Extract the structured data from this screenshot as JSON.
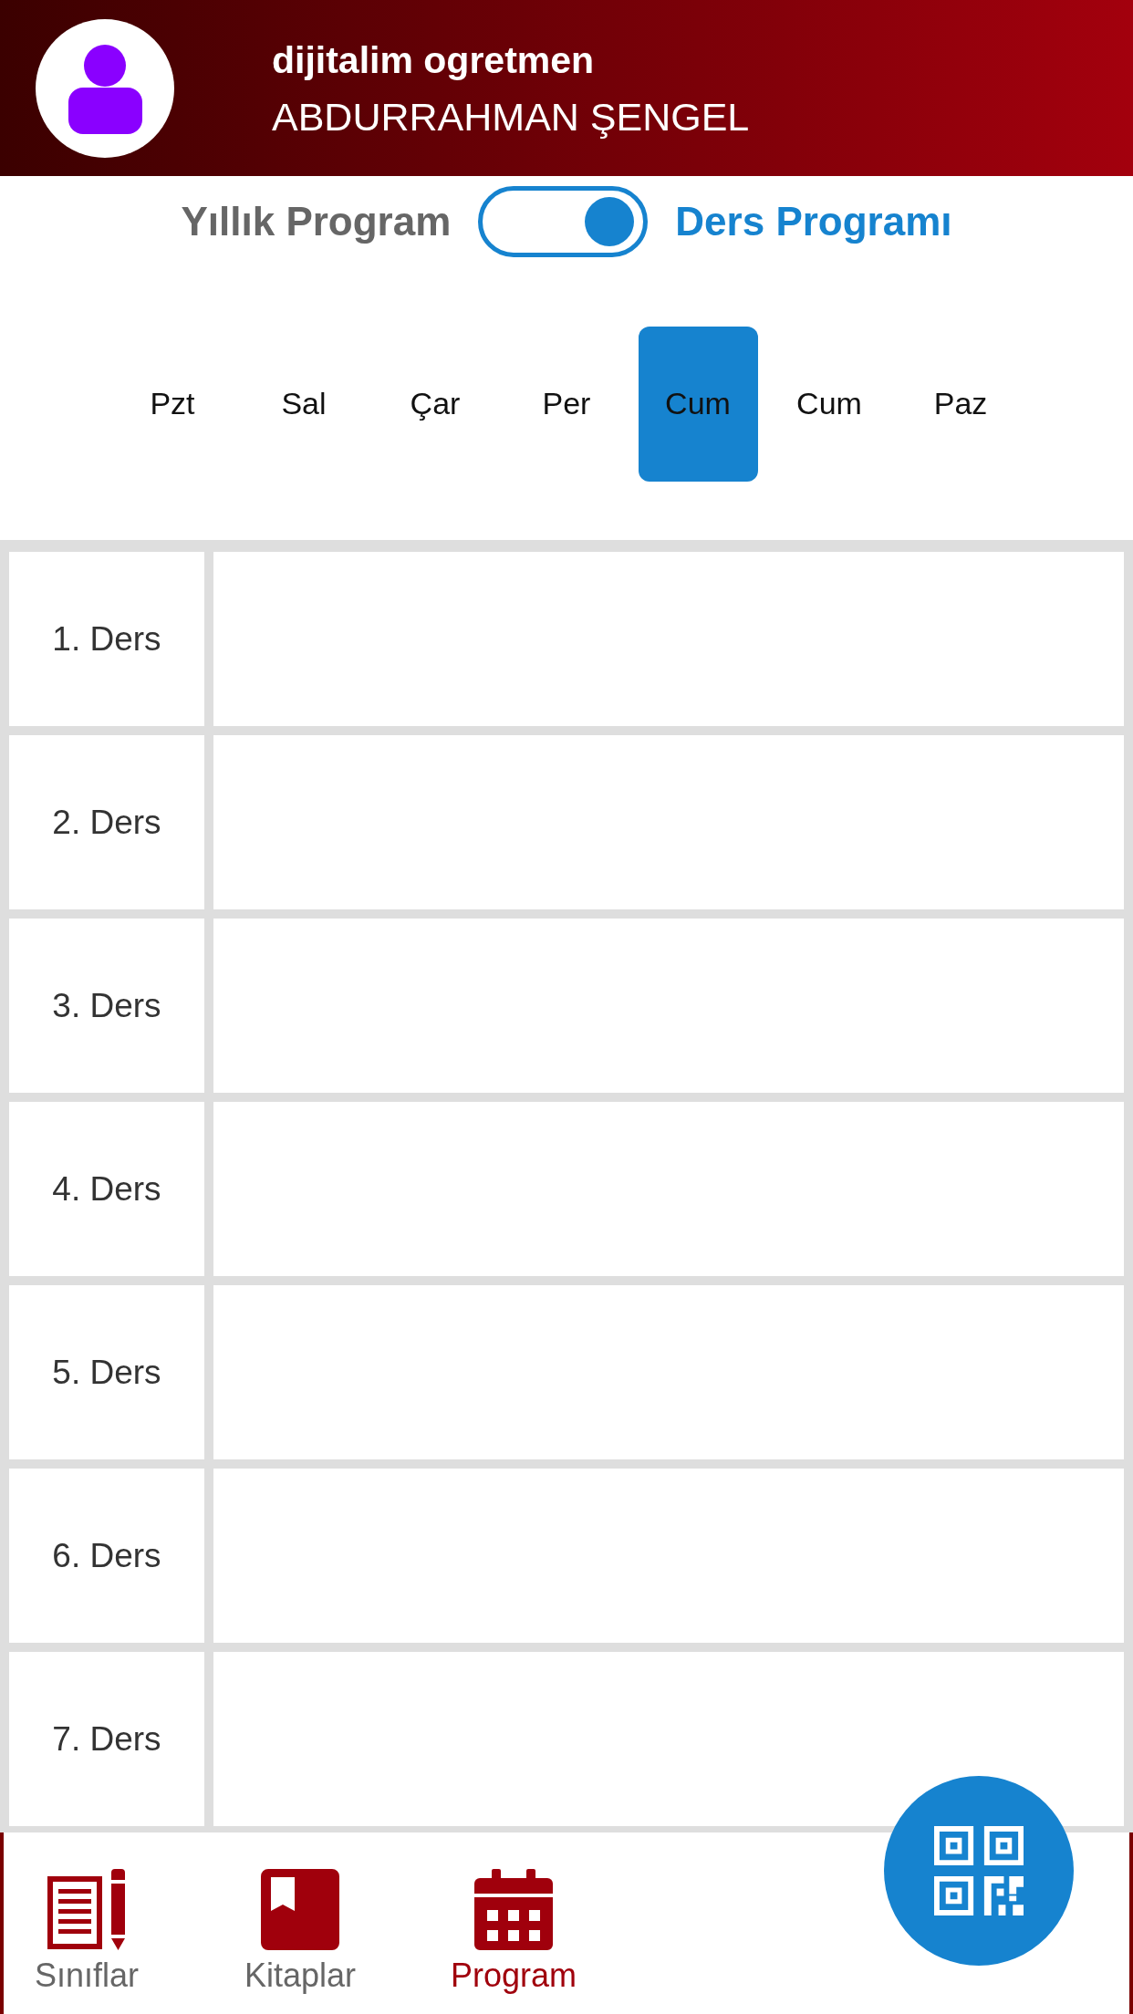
{
  "header": {
    "subtitle": "dijitalim ogretmen",
    "name": "ABDURRAHMAN ŞENGEL"
  },
  "mode_toggle": {
    "left_label": "Yıllık Program",
    "right_label": "Ders Programı",
    "on": true
  },
  "days": [
    {
      "label": "Pzt",
      "selected": false
    },
    {
      "label": "Sal",
      "selected": false
    },
    {
      "label": "Çar",
      "selected": false
    },
    {
      "label": "Per",
      "selected": false
    },
    {
      "label": "Cum",
      "selected": true
    },
    {
      "label": "Cum",
      "selected": false
    },
    {
      "label": "Paz",
      "selected": false
    }
  ],
  "lessons": [
    "1. Ders",
    "2. Ders",
    "3. Ders",
    "4. Ders",
    "5. Ders",
    "6. Ders",
    "7. Ders"
  ],
  "bottom_nav": [
    {
      "label": "Sınıflar",
      "kind": "classes",
      "selected": false
    },
    {
      "label": "Kitaplar",
      "kind": "books",
      "selected": false
    },
    {
      "label": "Program",
      "kind": "calendar",
      "selected": true
    }
  ]
}
